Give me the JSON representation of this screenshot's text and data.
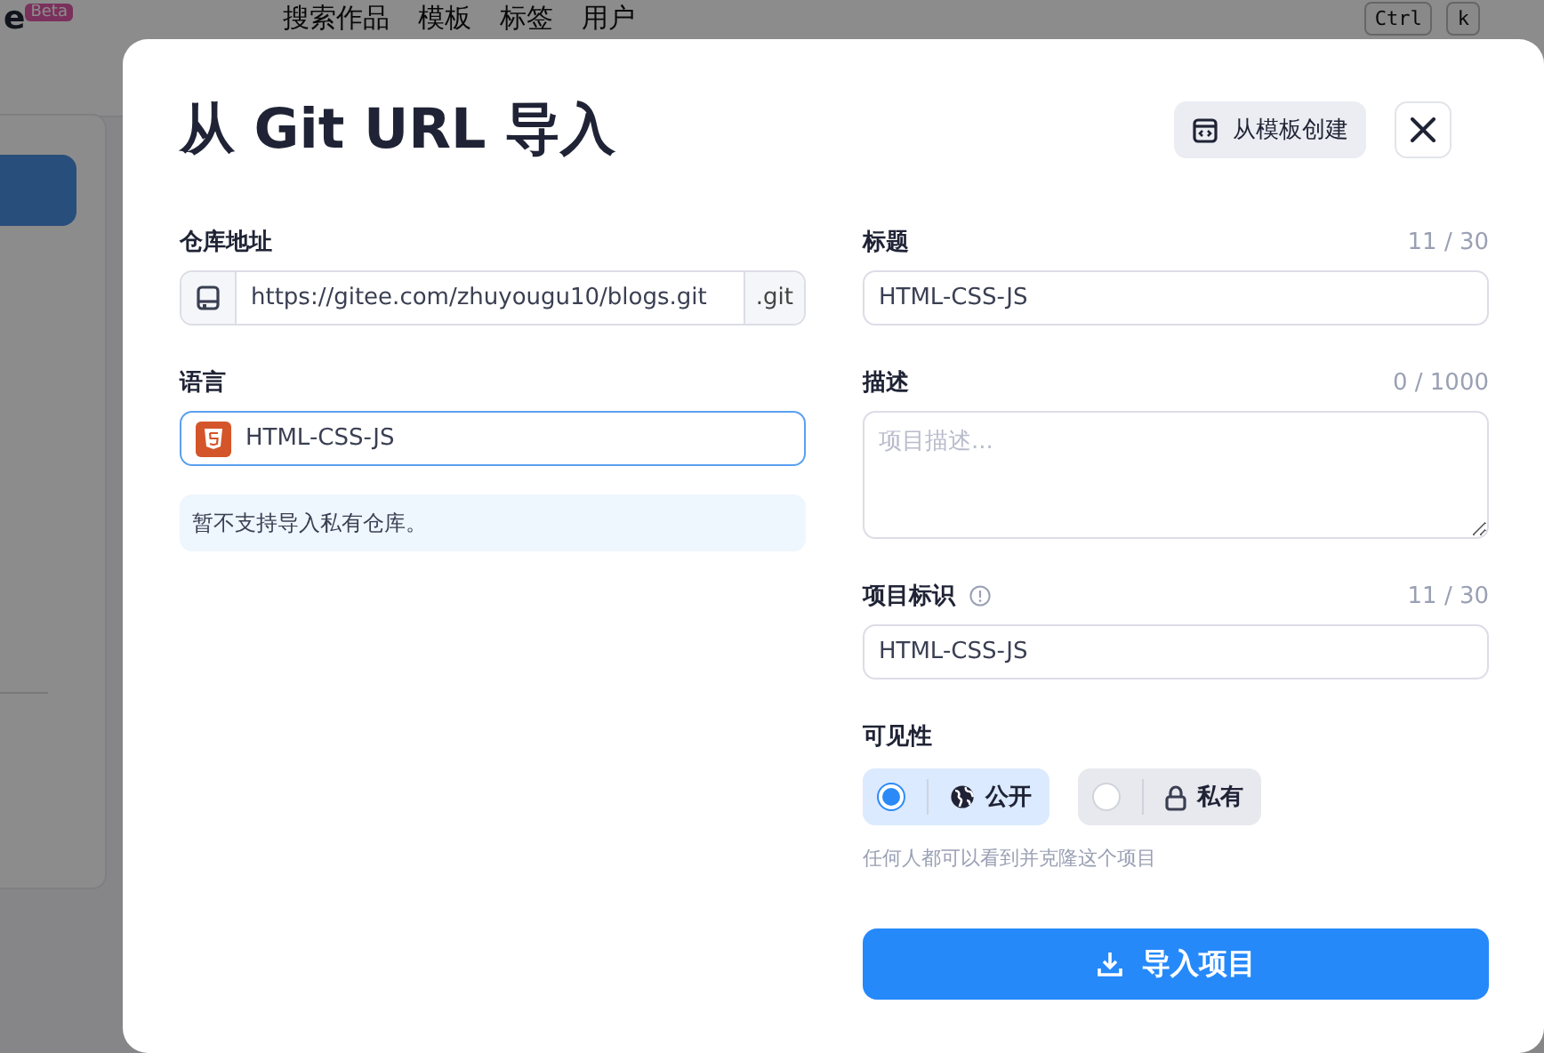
{
  "background": {
    "logo": "e",
    "badge": "Beta",
    "nav": [
      "搜索作品",
      "模板",
      "标签",
      "用户"
    ],
    "keys": [
      "Ctrl",
      "k"
    ]
  },
  "dialog": {
    "title": "从 Git URL 导入",
    "template_button": "从模板创建",
    "repo": {
      "label": "仓库地址",
      "value": "https://gitee.com/zhuyougu10/blogs.git",
      "suffix": ".git"
    },
    "language": {
      "label": "语言",
      "value": "HTML-CSS-JS",
      "focused": true
    },
    "note": "暂不支持导入私有仓库。",
    "title_field": {
      "label": "标题",
      "counter": "11 / 30",
      "value": "HTML-CSS-JS"
    },
    "description": {
      "label": "描述",
      "counter": "0 / 1000",
      "placeholder": "项目描述..."
    },
    "slug": {
      "label": "项目标识",
      "counter": "11 / 30",
      "value": "HTML-CSS-JS"
    },
    "visibility": {
      "label": "可见性",
      "options": [
        {
          "kind": "public",
          "label": "公开",
          "selected": true
        },
        {
          "kind": "private",
          "label": "私有",
          "selected": false
        }
      ],
      "hint": "任何人都可以看到并克隆这个项目"
    },
    "submit": "导入项目"
  }
}
